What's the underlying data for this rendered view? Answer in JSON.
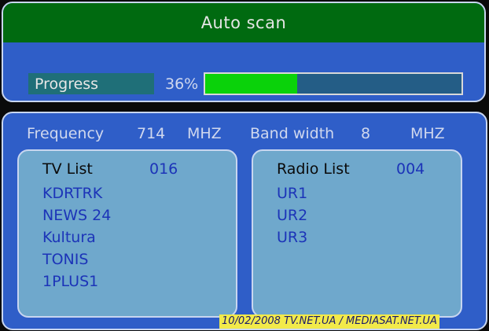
{
  "header": {
    "title": "Auto scan"
  },
  "progress": {
    "label": "Progress",
    "percent_text": "36%",
    "fraction": 0.36
  },
  "frequency": {
    "label": "Frequency",
    "value": "714",
    "unit": "MHZ"
  },
  "bandwidth": {
    "label": "Band width",
    "value": "8",
    "unit": "MHZ"
  },
  "tv_list": {
    "title": "TV List",
    "count": "016",
    "items": [
      "KDRTRK",
      "NEWS 24",
      "Kultura",
      "TONIS",
      "1PLUS1"
    ]
  },
  "radio_list": {
    "title": "Radio List",
    "count": "004",
    "items": [
      "UR1",
      "UR2",
      "UR3"
    ]
  },
  "watermark": {
    "text": "10/02/2008     TV.NET.UA / MEDIASAT.NET.UA"
  },
  "colors": {
    "panel_bg": "#2f5ec8",
    "title_bar": "#006a10",
    "progress_fill": "#0ad20a",
    "list_bg": "#6fa8cc",
    "value_highlight": "#e0c840",
    "list_text": "#1c34b8"
  }
}
